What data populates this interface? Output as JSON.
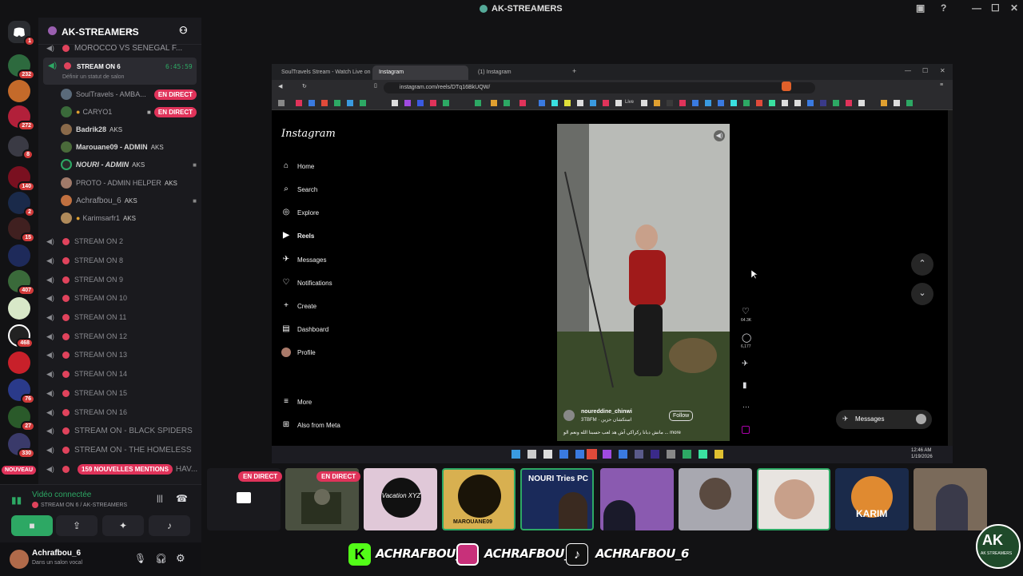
{
  "window": {
    "title": "AK-STREAMERS"
  },
  "server": {
    "name": "AK-STREAMERS",
    "badges": [
      "1",
      "232",
      "272",
      "8",
      "140",
      "2",
      "15",
      "407",
      "468",
      "76",
      "27",
      "330"
    ],
    "new_label": "NOUVEAU"
  },
  "channels": {
    "top_partial": "MOROCCO VS SENEGAL F...",
    "active": {
      "name": "STREAM ON 6",
      "timer": "6:45:59",
      "status": "Définir un statut de salon"
    },
    "users": [
      {
        "name": "SoulTravels - AMBA...",
        "badge": "EN DIRECT"
      },
      {
        "name": "CARYO1",
        "badge": "EN DIRECT"
      },
      {
        "name": "Badrik28",
        "tag": "AKS"
      },
      {
        "name": "Marouane09 - ADMIN",
        "tag": "AKS"
      },
      {
        "name": "NOURI - ADMIN",
        "tag": "AKS"
      },
      {
        "name": "PROTO - ADMIN HELPER",
        "tag": "AKS"
      },
      {
        "name": "Achrafbou_6",
        "tag": "AKS"
      },
      {
        "name": "Karimsarfr1",
        "tag": "AKS"
      }
    ],
    "list": [
      "STREAM ON 2",
      "STREAM ON 8",
      "STREAM ON 9",
      "STREAM ON 10",
      "STREAM ON 11",
      "STREAM ON 12",
      "STREAM ON 13",
      "STREAM ON 14",
      "STREAM ON 15",
      "STREAM ON 16",
      "STREAM ON - BLACK SPIDERS",
      "STREAM ON - THE HOMELESS"
    ],
    "last_partial": "HAV...",
    "mentions": "159 NOUVELLES MENTIONS"
  },
  "voice": {
    "status": "Vidéo connectée",
    "channel": "STREAM ON 6 / AK-STREAMERS"
  },
  "account": {
    "name": "Achrafbou_6",
    "status": "Dans un salon vocal"
  },
  "browser": {
    "tabs": [
      "SoulTravels Stream - Watch Live on K",
      "Instagram",
      "(1) Instagram"
    ],
    "url": "instagram.com/reels/DTq16BkUQW/",
    "bookmark_labels": [
      "Live"
    ],
    "instagram": {
      "logo": "Instagram",
      "nav": [
        "Home",
        "Search",
        "Explore",
        "Reels",
        "Messages",
        "Notifications",
        "Create",
        "Dashboard",
        "Profile"
      ],
      "bottom_nav": [
        "More",
        "Also from Meta"
      ],
      "reel": {
        "user": "noureddine_chinwi",
        "audio": "3TBFM · استكشان حزين",
        "follow": "Follow",
        "caption": "مانش دبانا ركراكي آش هد لعب حسبنا الله ونعم الو ... more",
        "likes": "64.3K",
        "comments": "6,177"
      },
      "messages_button": "Messages"
    },
    "taskbar": {
      "time": "12:46 AM",
      "date": "1/19/2026"
    }
  },
  "bottom_strip": {
    "live_labels": [
      "EN DIRECT",
      "EN DIRECT"
    ],
    "thumb_texts": [
      "Vacation XYZ",
      "MAROUANE09",
      "NOURI Tries PC",
      "KARIM"
    ]
  },
  "socials": [
    "ACHRAFBOU_6",
    "ACHRAFBOU_6",
    "ACHRAFBOU_6"
  ],
  "logo_text": "AK STREAMERS",
  "colors": {
    "accent": "#e0335a",
    "discord_green": "#2da864",
    "bg": "#121214"
  }
}
